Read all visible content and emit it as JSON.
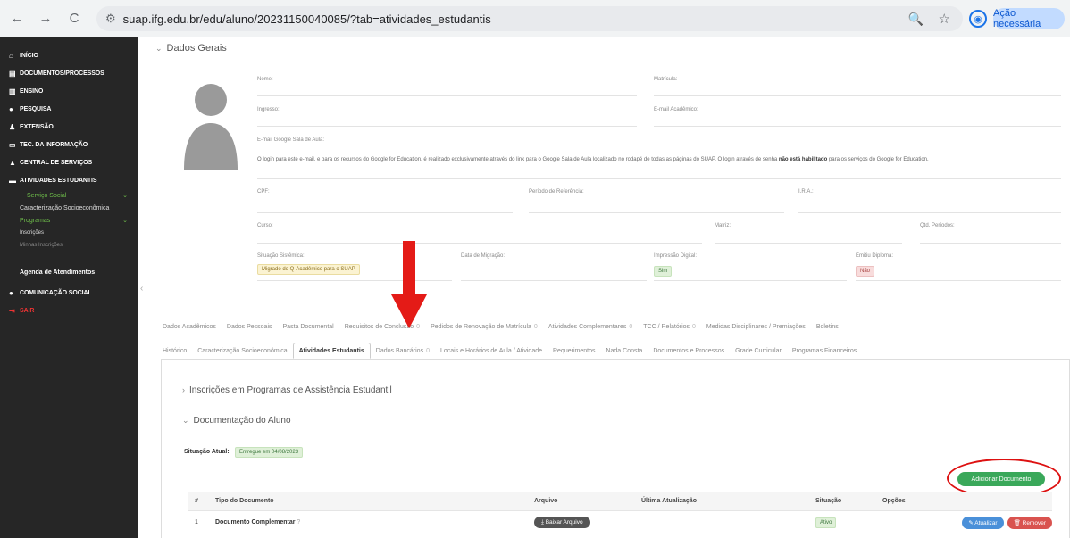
{
  "browser": {
    "url": "suap.ifg.edu.br/edu/aluno/20231150040085/?tab=atividades_estudantis",
    "action_label": "Ação necessária"
  },
  "sidebar": {
    "items": [
      {
        "label": "Início",
        "icon": "home-icon"
      },
      {
        "label": "Documentos/Processos",
        "icon": "file-icon"
      },
      {
        "label": "Ensino",
        "icon": "book-icon"
      },
      {
        "label": "Pesquisa",
        "icon": "flask-icon"
      },
      {
        "label": "Extensão",
        "icon": "people-icon"
      },
      {
        "label": "Tec. da Informação",
        "icon": "monitor-icon"
      },
      {
        "label": "Central de Serviços",
        "icon": "wrench-icon"
      },
      {
        "label": "Atividades Estudantis",
        "icon": "graduation-cap-icon"
      }
    ],
    "sub": {
      "servico_social": "Serviço Social",
      "caracterizacao": "Caracterização Socioeconômica",
      "programas": "Programas",
      "inscricoes": "Inscrições",
      "minhas_inscricoes": "Minhas Inscrições"
    },
    "agenda": "Agenda de Atendimentos",
    "comunicacao": "Comunicação Social",
    "sair": "Sair"
  },
  "dados_gerais": {
    "title": "Dados Gerais",
    "nome": "Nome:",
    "matricula": "Matrícula:",
    "ingresso": "Ingresso:",
    "email_academico": "E-mail Acadêmico:",
    "email_google": "E-mail Google Sala de Aula:",
    "info_text": "O login para este e-mail, e para os recursos do Google for Education, é realizado exclusivamente através do link para o Google Sala de Aula localizado no rodapé de todas as páginas do SUAP. O login através de senha",
    "info_bold": "não está habilitado",
    "info_text2": "para os serviços do Google for Education.",
    "cpf": "CPF:",
    "periodo_ref": "Período de Referência:",
    "ira": "I.R.A.:",
    "curso": "Curso:",
    "matriz": "Matriz:",
    "qtd_periodos": "Qtd. Períodos:",
    "situacao_sistemica": "Situação Sistêmica:",
    "situacao_sistemica_val": "Migrado do Q-Acadêmico para o SUAP",
    "data_migracao": "Data de Migração:",
    "impressao_digital": "Impressão Digital:",
    "impressao_digital_val": "Sim",
    "emitiu_diploma": "Emitiu Diploma:",
    "emitiu_diploma_val": "Não"
  },
  "tabs_row1": [
    "Dados Acadêmicos",
    "Dados Pessoais",
    "Pasta Documental",
    "Requisitos de Conclusão",
    "Pedidos de Renovação de Matrícula",
    "Atividades Complementares",
    "TCC / Relatórios",
    "Medidas Disciplinares / Premiações",
    "Boletins"
  ],
  "tabs_row1_counts": [
    "",
    "",
    "",
    "0",
    "0",
    "0",
    "0",
    "",
    ""
  ],
  "tabs_row2": [
    "Histórico",
    "Caracterização Socioeconômica",
    "Atividades Estudantis",
    "Dados Bancários",
    "Locais e Horários de Aula / Atividade",
    "Requerimentos",
    "Nada Consta",
    "Documentos e Processos",
    "Grade Curricular",
    "Programas Financeiros"
  ],
  "tabs_row2_counts": [
    "",
    "",
    "",
    "0",
    "",
    "",
    "",
    "",
    "",
    ""
  ],
  "panel": {
    "inscricoes_title": "Inscrições em Programas de Assistência Estudantil",
    "doc_title": "Documentação do Aluno",
    "situacao_label": "Situação Atual:",
    "situacao_value": "Entregue em 04/08/2023",
    "add_button": "Adicionar Documento"
  },
  "table": {
    "headers": [
      "#",
      "Tipo do Documento",
      "Arquivo",
      "Última Atualização",
      "Situação",
      "Opções"
    ],
    "rows": [
      {
        "num": "1",
        "tipo": "Documento Complementar",
        "arquivo": "Baixar Arquivo",
        "atualizacao": "",
        "situacao": "Ativo",
        "atualizar": "Atualizar",
        "remover": "Remover"
      }
    ]
  }
}
